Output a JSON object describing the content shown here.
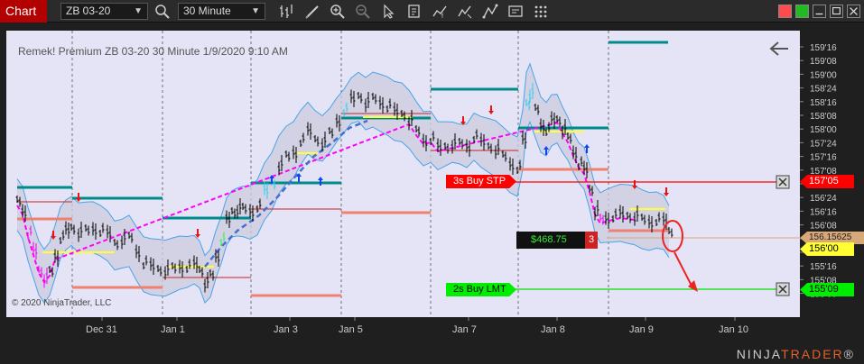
{
  "toolbar": {
    "tab_label": "Chart",
    "instrument": "ZB 03-20",
    "interval": "30 Minute"
  },
  "chart": {
    "info": "Remek!  Premium  ZB 03-20  30 Minute  1/9/2020 9:10 AM",
    "copyright": "© 2020 NinjaTrader, LLC",
    "price_labels": [
      "159'16",
      "159'08",
      "159'00",
      "158'24",
      "158'16",
      "158'08",
      "158'00",
      "157'24",
      "157'16",
      "157'08",
      "157'00",
      "156'24",
      "156'16",
      "156'08",
      "156'00",
      "155'24",
      "155'16",
      "155'08",
      "155'00"
    ],
    "date_labels": [
      "Dec 31",
      "Jan 1",
      "Jan 3",
      "Jan 5",
      "Jan 7",
      "Jan 8",
      "Jan 9",
      "Jan 10"
    ],
    "stop_order": {
      "label": "3s  Buy STP",
      "price": "157'05"
    },
    "limit_order": {
      "label": "2s  Buy LMT",
      "price": "155'09"
    },
    "position": {
      "pnl": "$468.75",
      "qty": "3"
    },
    "last_price": "156.15625",
    "current_price": "156'00",
    "colors": {
      "stop": "#ff0000",
      "limit": "#00dd00",
      "teal": "#008b8b",
      "salmon": "#f08070",
      "band": "#4aa3e8"
    }
  },
  "footer": {
    "logo_a": "NINJA",
    "logo_b": "TRADER",
    "logo_reg": "®"
  }
}
